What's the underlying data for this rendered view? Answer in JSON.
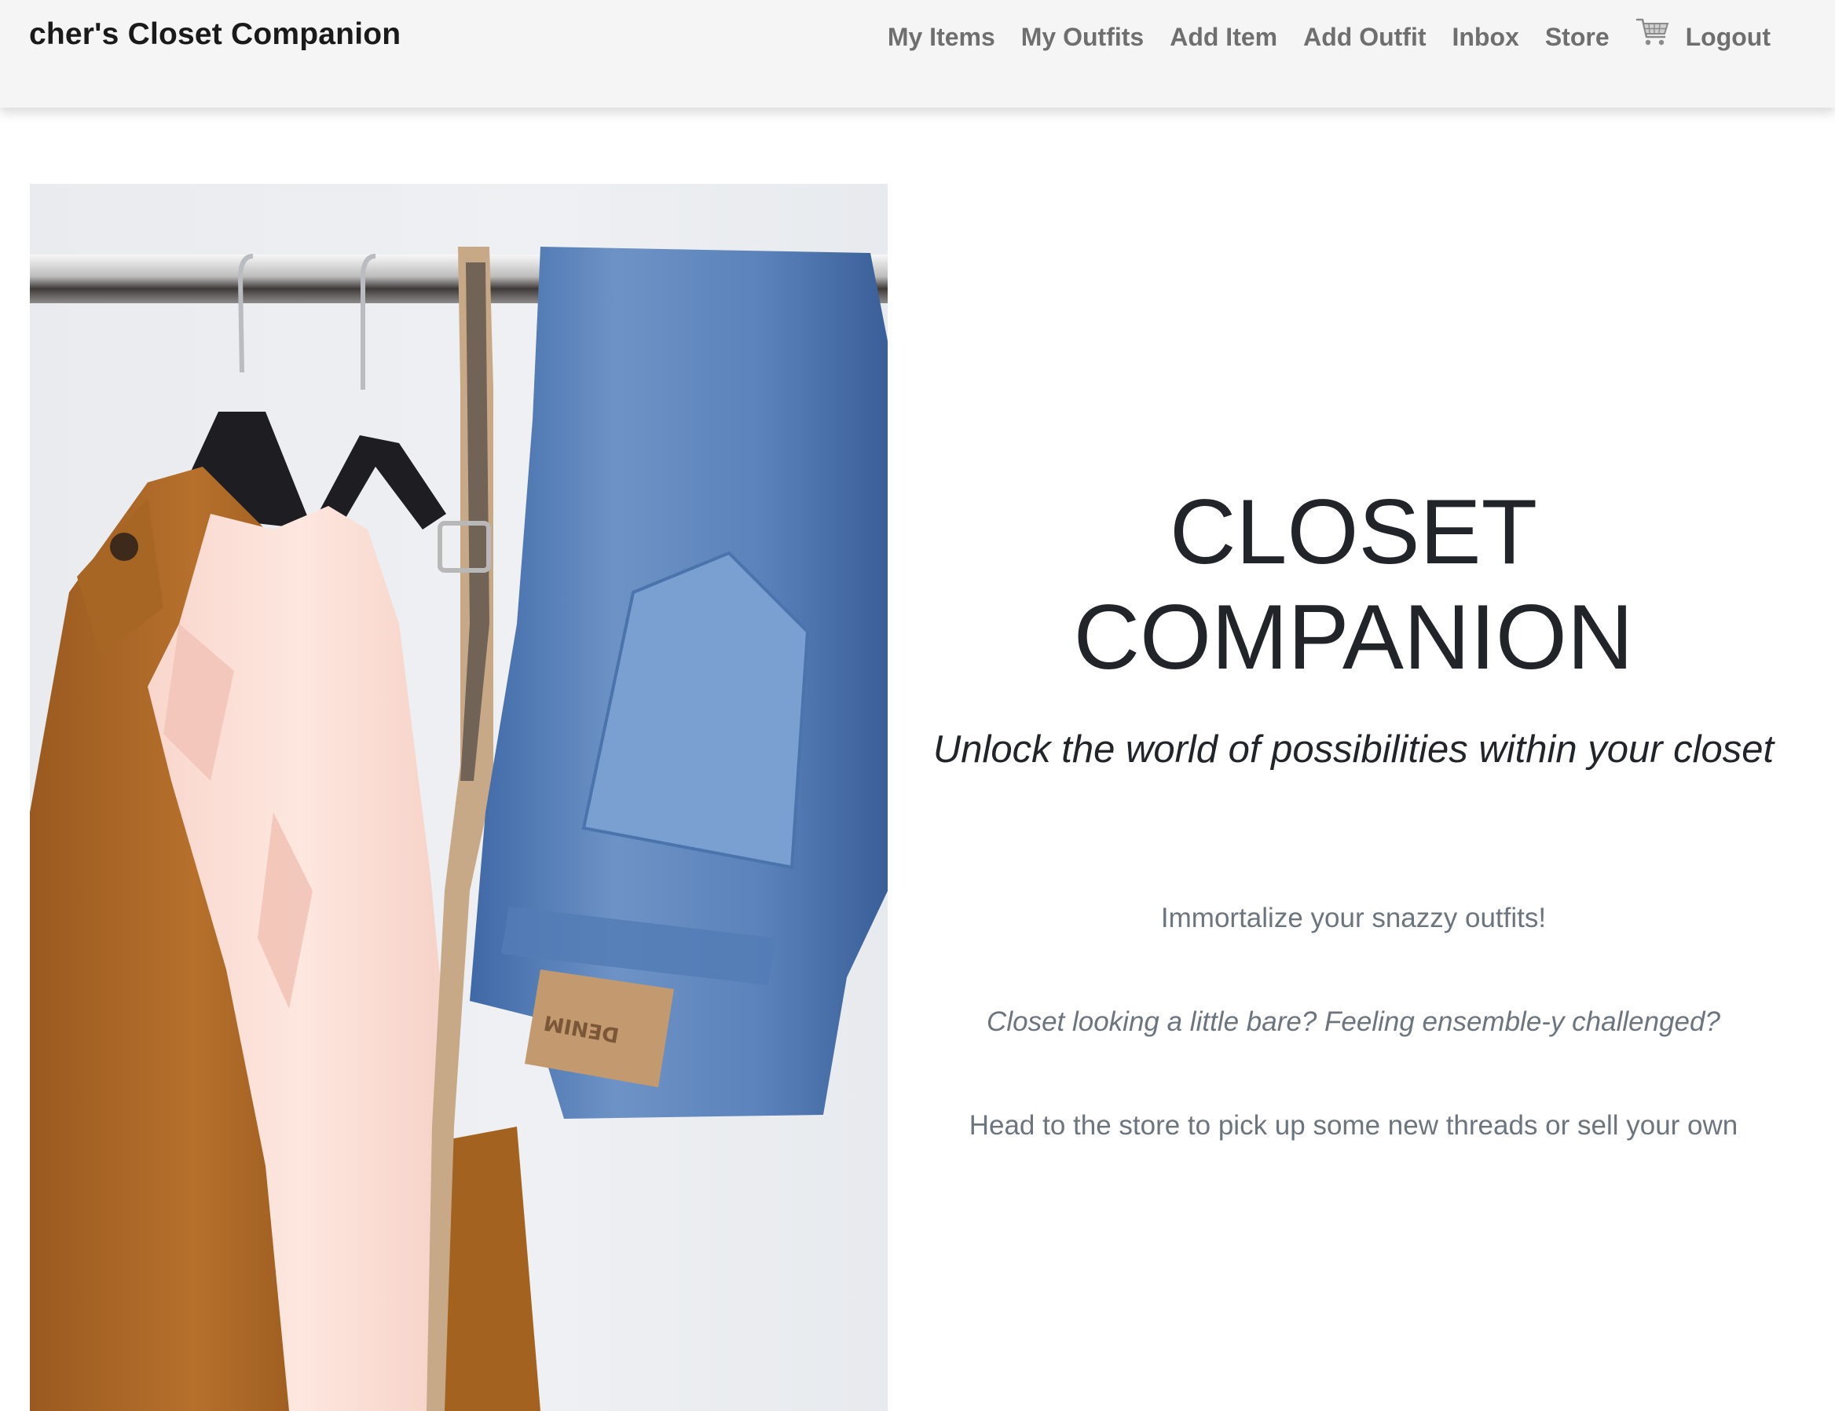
{
  "navbar": {
    "brand": "cher's Closet Companion",
    "links": [
      "My Items",
      "My Outfits",
      "Add Item",
      "Add Outfit",
      "Inbox",
      "Store"
    ],
    "cart_icon": "shopping-cart-icon",
    "logout": "Logout"
  },
  "hero": {
    "image": "clothes-rack-photo",
    "title_line1": "CLOSET",
    "title_line2": "COMPANION",
    "subtitle": "Unlock the world of possibilities within your closet",
    "blurbs": [
      "Immortalize your snazzy outfits!",
      "Closet looking a little bare? Feeling ensemble-y challenged?",
      "Head to the store to pick up some new threads or sell your own"
    ],
    "photo_label": "DENIM"
  },
  "colors": {
    "navbar_bg": "#f5f5f5",
    "nav_link": "#6f6f6f",
    "title": "#212529",
    "muted": "#6c757d"
  }
}
